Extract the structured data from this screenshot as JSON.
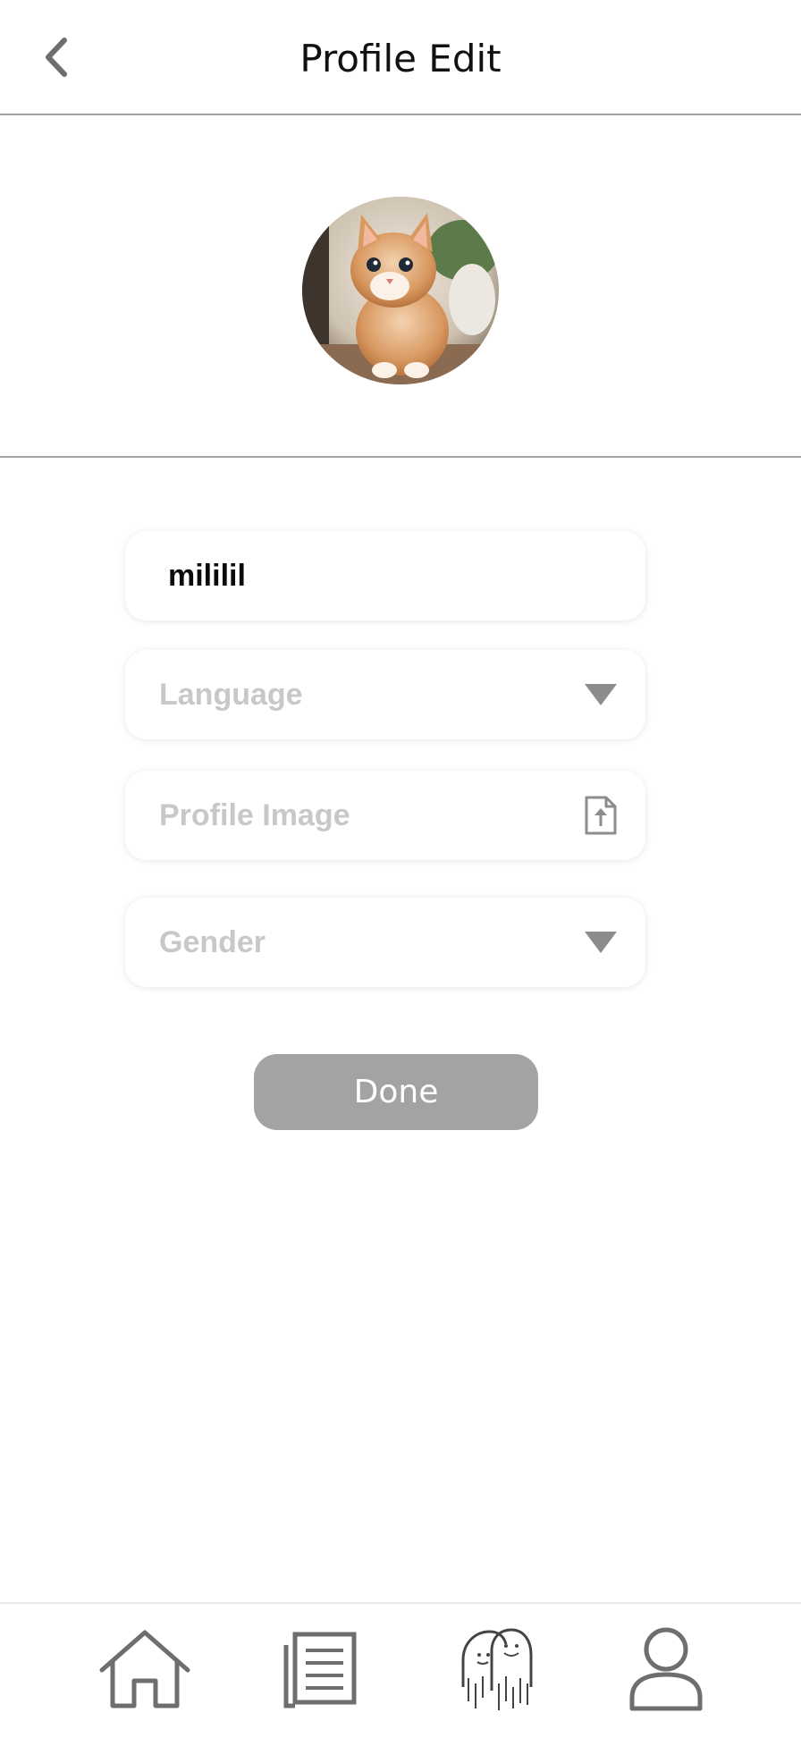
{
  "header": {
    "title": "Profile Edit",
    "back_icon": "chevron-left-icon"
  },
  "profile": {
    "avatar_description": "kitten-photo"
  },
  "form": {
    "nickname_value": "mililil",
    "language_placeholder": "Language",
    "profile_image_placeholder": "Profile Image",
    "gender_placeholder": "Gender",
    "dropdown_icon": "caret-down-icon",
    "upload_icon": "file-upload-icon"
  },
  "actions": {
    "done_label": "Done",
    "done_color": "#a3a3a3"
  },
  "bottom_nav": {
    "items": [
      {
        "icon": "home-icon"
      },
      {
        "icon": "list-icon"
      },
      {
        "icon": "community-icon"
      },
      {
        "icon": "profile-icon"
      }
    ]
  },
  "colors": {
    "divider": "#a3a3a3",
    "icon_gray": "#6e6e6e",
    "placeholder": "#c8c8c8"
  }
}
